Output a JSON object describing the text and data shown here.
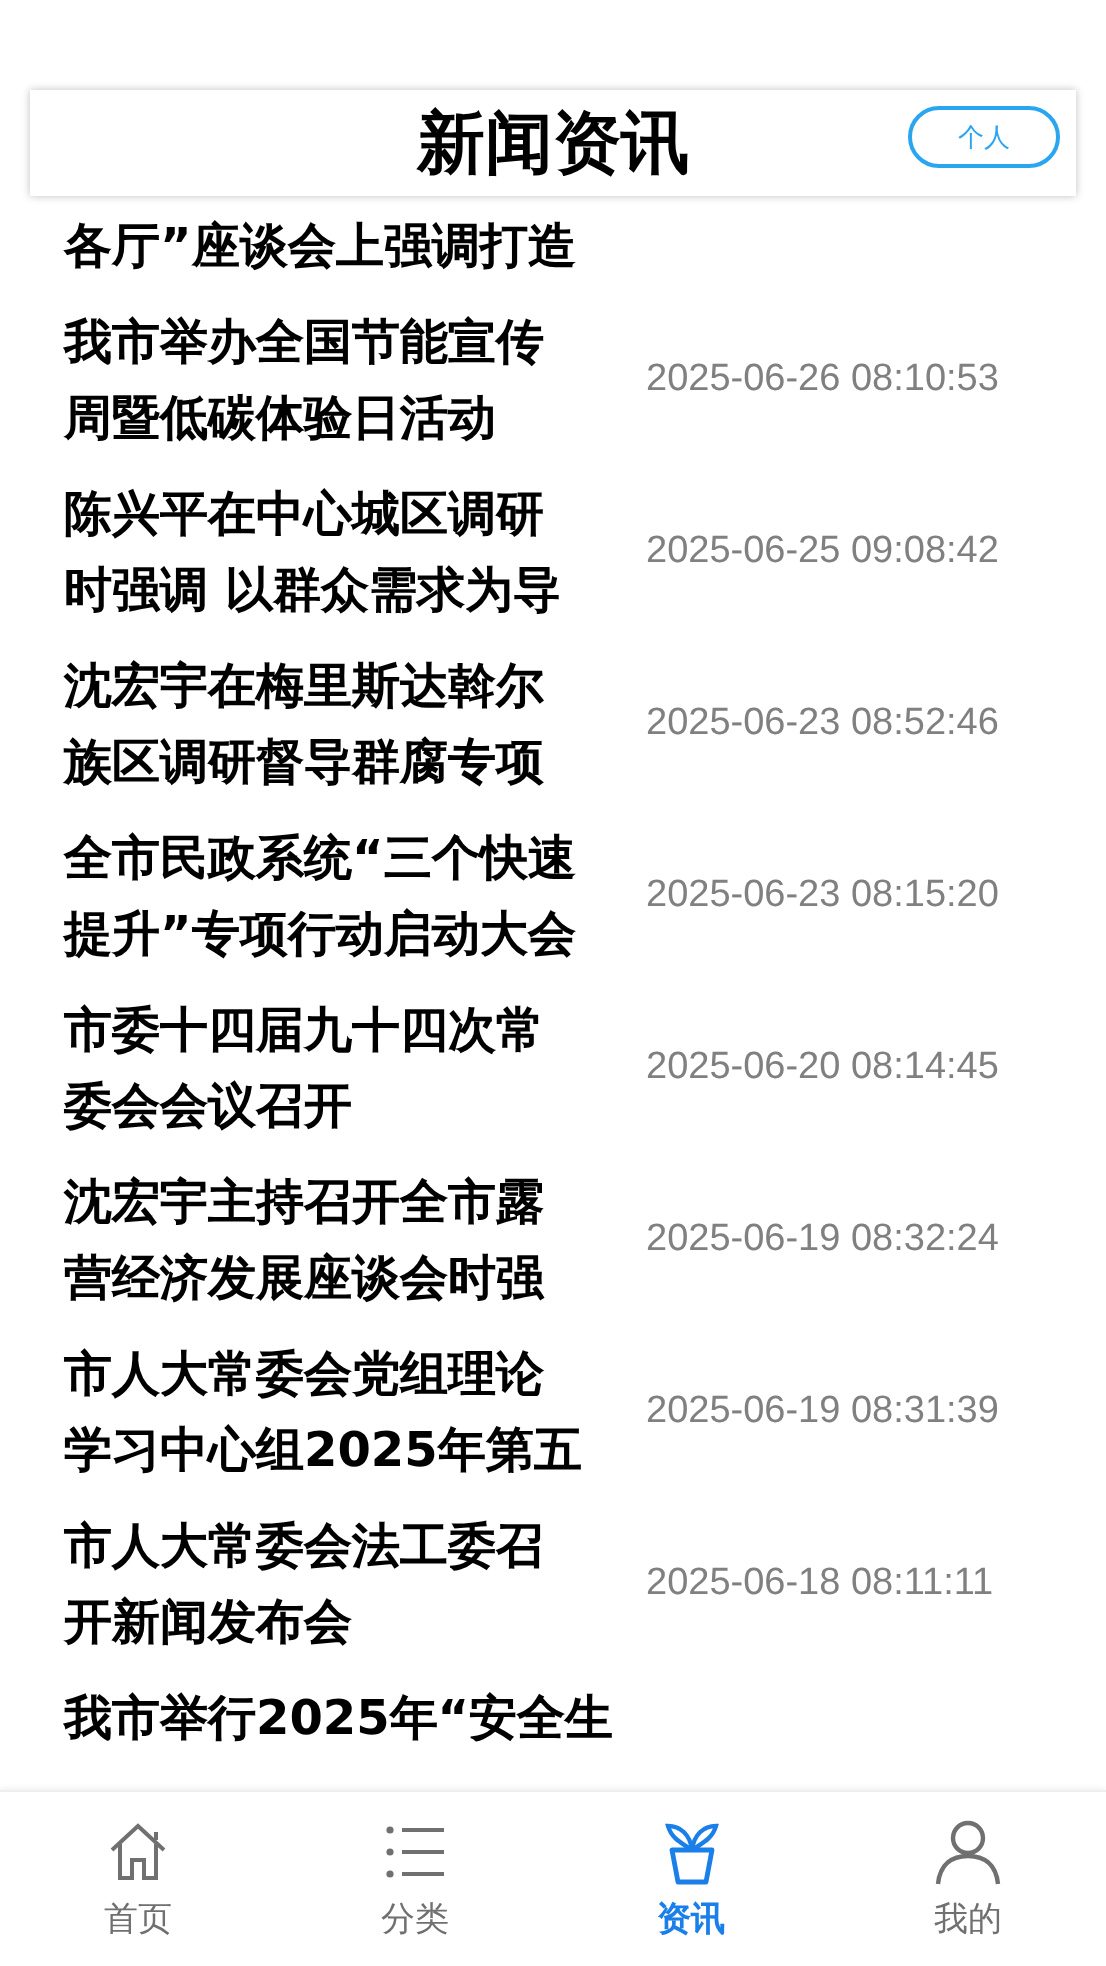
{
  "header": {
    "title": "新闻资讯",
    "button": "个人"
  },
  "news": [
    {
      "title_lines": [
        "各厅”座谈会上强调打造"
      ]
    },
    {
      "title_lines": [
        "我市举办全国节能宣传",
        "周暨低碳体验日活动"
      ],
      "time": "2025-06-26 08:10:53"
    },
    {
      "title_lines": [
        "陈兴平在中心城区调研",
        "时强调 以群众需求为导"
      ],
      "time": "2025-06-25 09:08:42"
    },
    {
      "title_lines": [
        "沈宏宇在梅里斯达斡尔",
        "族区调研督导群腐专项"
      ],
      "time": "2025-06-23 08:52:46"
    },
    {
      "title_lines": [
        "全市民政系统“三个快速",
        "提升”专项行动启动大会"
      ],
      "time": "2025-06-23 08:15:20"
    },
    {
      "title_lines": [
        "市委十四届九十四次常",
        "委会会议召开"
      ],
      "time": "2025-06-20 08:14:45"
    },
    {
      "title_lines": [
        "沈宏宇主持召开全市露",
        "营经济发展座谈会时强"
      ],
      "time": "2025-06-19 08:32:24"
    },
    {
      "title_lines": [
        "市人大常委会党组理论",
        "学习中心组2025年第五"
      ],
      "time": "2025-06-19 08:31:39"
    },
    {
      "title_lines": [
        "市人大常委会法工委召",
        "开新闻发布会"
      ],
      "time": "2025-06-18 08:11:11"
    },
    {
      "title_lines": [
        "我市举行2025年“安全生"
      ]
    }
  ],
  "tabs": [
    {
      "kind": "home",
      "label": "首页",
      "selected": false
    },
    {
      "kind": "list",
      "label": "分类",
      "selected": false
    },
    {
      "kind": "plant",
      "label": "资讯",
      "selected": true
    },
    {
      "kind": "person",
      "label": "我的",
      "selected": false
    }
  ]
}
